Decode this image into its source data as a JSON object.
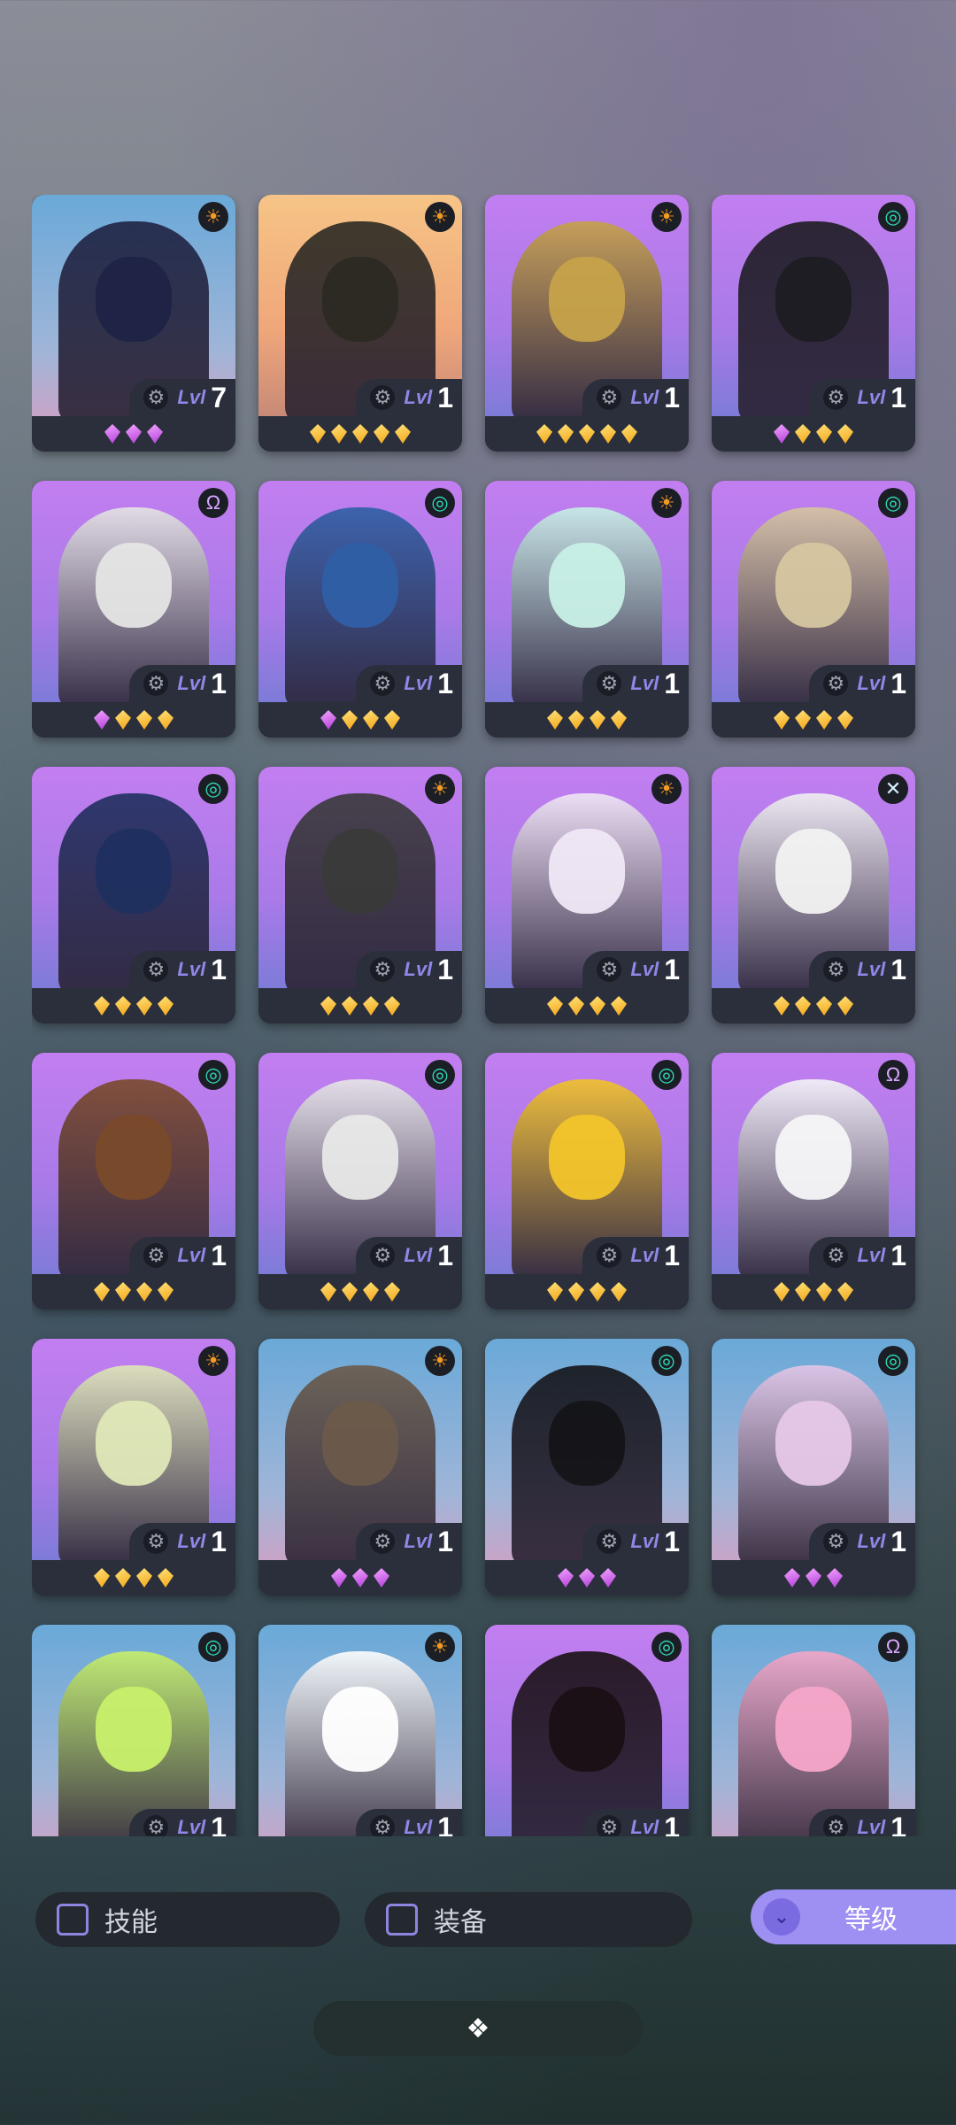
{
  "colors": {
    "bg_sky": "#6aa9d8",
    "bg_violet": "#c27ef0",
    "bg_peach": "#f0b27a",
    "lvl_label": "#8f88e8",
    "accent": "#9e8ff3"
  },
  "heroes": [
    {
      "bg": "sky",
      "el": "sun",
      "lvl_label": "Lvl",
      "level": "7",
      "gems": [
        "purple",
        "purple",
        "purple"
      ],
      "tone": "#1f2344"
    },
    {
      "bg": "peach",
      "el": "sun",
      "lvl_label": "Lvl",
      "level": "1",
      "gems": [
        "gold",
        "gold",
        "gold",
        "gold",
        "gold"
      ],
      "tone": "#2b2a22"
    },
    {
      "bg": "violet",
      "el": "sun",
      "lvl_label": "Lvl",
      "level": "1",
      "gems": [
        "gold",
        "gold",
        "gold",
        "gold",
        "gold"
      ],
      "tone": "#c6a24a"
    },
    {
      "bg": "violet",
      "el": "wind",
      "lvl_label": "Lvl",
      "level": "1",
      "gems": [
        "purple",
        "gold",
        "gold",
        "gold"
      ],
      "tone": "#1c1c22"
    },
    {
      "bg": "violet",
      "el": "omega",
      "lvl_label": "Lvl",
      "level": "1",
      "gems": [
        "purple",
        "gold",
        "gold",
        "gold"
      ],
      "tone": "#e5e5e5"
    },
    {
      "bg": "violet",
      "el": "wind",
      "lvl_label": "Lvl",
      "level": "1",
      "gems": [
        "purple",
        "gold",
        "gold",
        "gold"
      ],
      "tone": "#2f5fa5"
    },
    {
      "bg": "violet",
      "el": "sun",
      "lvl_label": "Lvl",
      "level": "1",
      "gems": [
        "gold",
        "gold",
        "gold",
        "gold"
      ],
      "tone": "#c8f0e6"
    },
    {
      "bg": "violet",
      "el": "wind",
      "lvl_label": "Lvl",
      "level": "1",
      "gems": [
        "gold",
        "gold",
        "gold",
        "gold"
      ],
      "tone": "#d6c6a0"
    },
    {
      "bg": "violet",
      "el": "wind",
      "lvl_label": "Lvl",
      "level": "1",
      "gems": [
        "gold",
        "gold",
        "gold",
        "gold"
      ],
      "tone": "#1f3060"
    },
    {
      "bg": "violet",
      "el": "sun",
      "lvl_label": "Lvl",
      "level": "1",
      "gems": [
        "gold",
        "gold",
        "gold",
        "gold"
      ],
      "tone": "#3a3a3a"
    },
    {
      "bg": "violet",
      "el": "sun",
      "lvl_label": "Lvl",
      "level": "1",
      "gems": [
        "gold",
        "gold",
        "gold",
        "gold"
      ],
      "tone": "#f0e8f5"
    },
    {
      "bg": "violet",
      "el": "cross",
      "lvl_label": "Lvl",
      "level": "1",
      "gems": [
        "gold",
        "gold",
        "gold",
        "gold"
      ],
      "tone": "#f2f2f2"
    },
    {
      "bg": "violet",
      "el": "wind",
      "lvl_label": "Lvl",
      "level": "1",
      "gems": [
        "gold",
        "gold",
        "gold",
        "gold"
      ],
      "tone": "#7a4a2a"
    },
    {
      "bg": "violet",
      "el": "wind",
      "lvl_label": "Lvl",
      "level": "1",
      "gems": [
        "gold",
        "gold",
        "gold",
        "gold"
      ],
      "tone": "#e8e8e8"
    },
    {
      "bg": "violet",
      "el": "wind",
      "lvl_label": "Lvl",
      "level": "1",
      "gems": [
        "gold",
        "gold",
        "gold",
        "gold"
      ],
      "tone": "#f2c42a"
    },
    {
      "bg": "violet",
      "el": "omega",
      "lvl_label": "Lvl",
      "level": "1",
      "gems": [
        "gold",
        "gold",
        "gold",
        "gold"
      ],
      "tone": "#f5f5f8"
    },
    {
      "bg": "violet",
      "el": "sun",
      "lvl_label": "Lvl",
      "level": "1",
      "gems": [
        "gold",
        "gold",
        "gold",
        "gold"
      ],
      "tone": "#dfe8b8"
    },
    {
      "bg": "sky",
      "el": "sun",
      "lvl_label": "Lvl",
      "level": "1",
      "gems": [
        "purple",
        "purple",
        "purple"
      ],
      "tone": "#6b5a4a"
    },
    {
      "bg": "sky",
      "el": "wind",
      "lvl_label": "Lvl",
      "level": "1",
      "gems": [
        "purple",
        "purple",
        "purple"
      ],
      "tone": "#141418"
    },
    {
      "bg": "sky",
      "el": "wind",
      "lvl_label": "Lvl",
      "level": "1",
      "gems": [
        "purple",
        "purple",
        "purple"
      ],
      "tone": "#e6c7e8"
    },
    {
      "bg": "sky",
      "el": "wind",
      "lvl_label": "Lvl",
      "level": "1",
      "gems": [],
      "tone": "#c8f06a"
    },
    {
      "bg": "sky",
      "el": "sun",
      "lvl_label": "Lvl",
      "level": "1",
      "gems": [],
      "tone": "#ffffff"
    },
    {
      "bg": "violet",
      "el": "wind",
      "lvl_label": "Lvl",
      "level": "1",
      "gems": [],
      "tone": "#1a1014"
    },
    {
      "bg": "sky",
      "el": "omega",
      "lvl_label": "Lvl",
      "level": "1",
      "gems": [],
      "tone": "#f5a7c8"
    }
  ],
  "filters": {
    "skill_label": "技能",
    "equip_label": "装备"
  },
  "sort": {
    "label": "等级",
    "icon": "chevron-double-down-icon"
  },
  "bottom_button": {
    "icon": "diamond-cluster-icon",
    "glyph": "❖"
  }
}
